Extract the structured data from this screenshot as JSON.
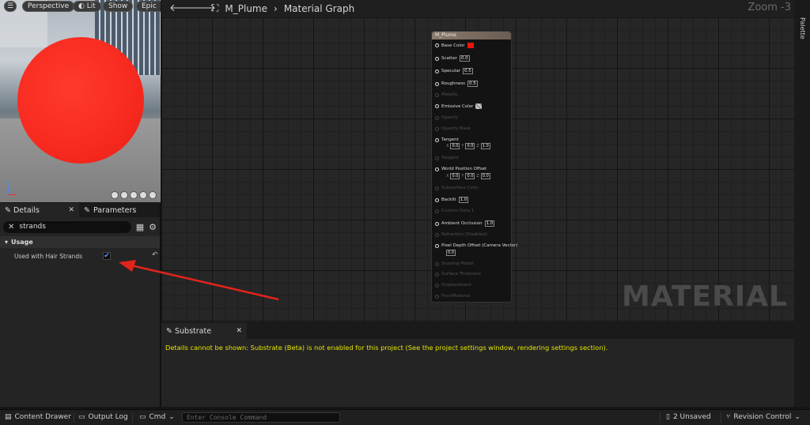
{
  "viewport": {
    "perspective_label": "Perspective",
    "lit_label": "Lit",
    "show_label": "Show",
    "epic_label": "Epic",
    "axes_label": "z"
  },
  "details": {
    "tab_details": "Details",
    "tab_parameters": "Parameters",
    "search_value": "strands",
    "section_usage": "Usage",
    "prop_hair_label": "Used with Hair Strands",
    "prop_hair_checked": "✔"
  },
  "topbar": {
    "asset_name": "M_Plume",
    "graph_name": "Material Graph",
    "zoom_label": "Zoom -3"
  },
  "node": {
    "title": "M_Plume",
    "base_color": "Base Color",
    "base_color_swatch": "#e8150f",
    "scatter": "Scatter",
    "scatter_val": "0.0",
    "specular": "Specular",
    "specular_val": "0.5",
    "roughness": "Roughness",
    "roughness_val": "0.5",
    "metallic": "Metallic",
    "emissive": "Emissive Color",
    "opacity": "Opacity",
    "opacity_mask": "Opacity Mask",
    "tangent": "Tangent",
    "tangent_x": "0.0",
    "tangent_y": "0.0",
    "tangent_z": "1.0",
    "tangent2": "Tangent",
    "wpo": "World Position Offset",
    "wpo_x": "0.0",
    "wpo_y": "0.0",
    "wpo_z": "0.0",
    "subsurface": "Subsurface Color",
    "backlit": "Backlit",
    "backlit_val": "1.0",
    "custom_data": "Custom Data 1",
    "ao": "Ambient Occlusion",
    "ao_val": "1.0",
    "refraction": "Refraction (Disabled)",
    "pdo": "Pixel Depth Offset (Camera Vector)",
    "pdo_val": "0.0",
    "shading_model": "Shading Model",
    "surface_thickness": "Surface Thickness",
    "displacement": "Displacement",
    "front_material": "FrontMaterial",
    "lbl_x": "X",
    "lbl_y": "Y",
    "lbl_z": "Z"
  },
  "graph": {
    "watermark": "MATERIAL"
  },
  "substrate": {
    "tab_label": "Substrate",
    "message": "Details cannot be shown: Substrate (Beta) is not enabled for this project (See the project settings window, rendering settings section)."
  },
  "palette": {
    "label": "Palette"
  },
  "bottombar": {
    "content_drawer": "Content Drawer",
    "output_log": "Output Log",
    "cmd": "Cmd",
    "console_placeholder": "Enter Console Command",
    "unsaved": "2 Unsaved",
    "revision_control": "Revision Control"
  },
  "colors": {
    "accent_blue": "#4ea2ff",
    "annotation_red": "#e0241c",
    "warning_yellow": "#e6e600"
  }
}
